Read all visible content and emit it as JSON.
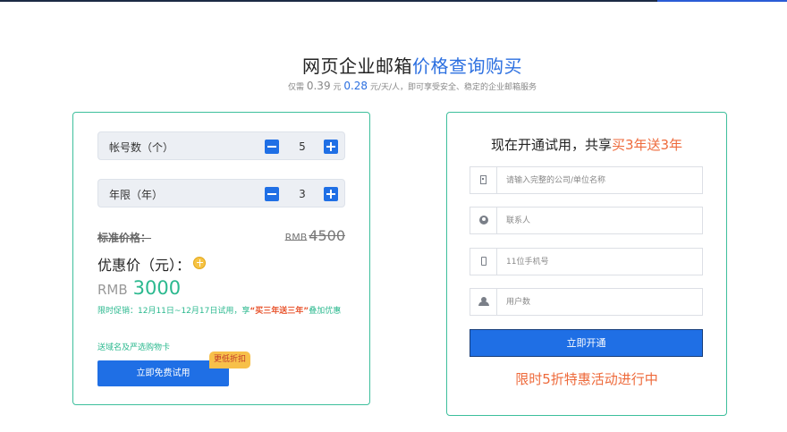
{
  "hero": {
    "title_main": "网页企业邮箱",
    "title_highlight": "价格查询购买",
    "sub_prefix": "仅需",
    "price_a": "0.39",
    "unit_a": "元",
    "price_b": "0.28",
    "sub_suffix": "元/天/人，即可享受安全、稳定的企业邮箱服务"
  },
  "calculator": {
    "accounts": {
      "label": "帐号数（个）",
      "value": "5"
    },
    "years": {
      "label": "年限（年）",
      "value": "3"
    },
    "standard_label": "标准价格：",
    "standard_currency": "RMB",
    "standard_amount": "4500",
    "promo_label": "优惠价（元）：",
    "promo_currency": "RMB",
    "promo_amount": "3000",
    "promo_text_prefix": "限时促销：12月11日~12月17日试用，享",
    "promo_text_highlight": "“买三年送三年”",
    "promo_text_suffix": "叠加优惠",
    "gift_text": "送域名及严选购物卡",
    "trial_button": "立即免费试用",
    "badge": "更低折扣"
  },
  "signup": {
    "title_prefix": "现在开通试用，共享",
    "title_highlight": "买3年送3年",
    "fields": {
      "company_placeholder": "请输入完整的公司/单位名称",
      "contact_placeholder": "联系人",
      "phone_placeholder": "11位手机号",
      "users_placeholder": "用户数"
    },
    "submit": "立即开通",
    "footer": "限时5折特惠活动进行中"
  },
  "colors": {
    "accent_blue": "#1f6fe5",
    "accent_green": "#2cb98f",
    "accent_orange": "#ee6a3b",
    "card_border": "#3dbf9c"
  },
  "icons": [
    "minus-icon",
    "plus-icon",
    "coin-icon",
    "building-icon",
    "user-icon",
    "phone-icon",
    "group-icon"
  ]
}
